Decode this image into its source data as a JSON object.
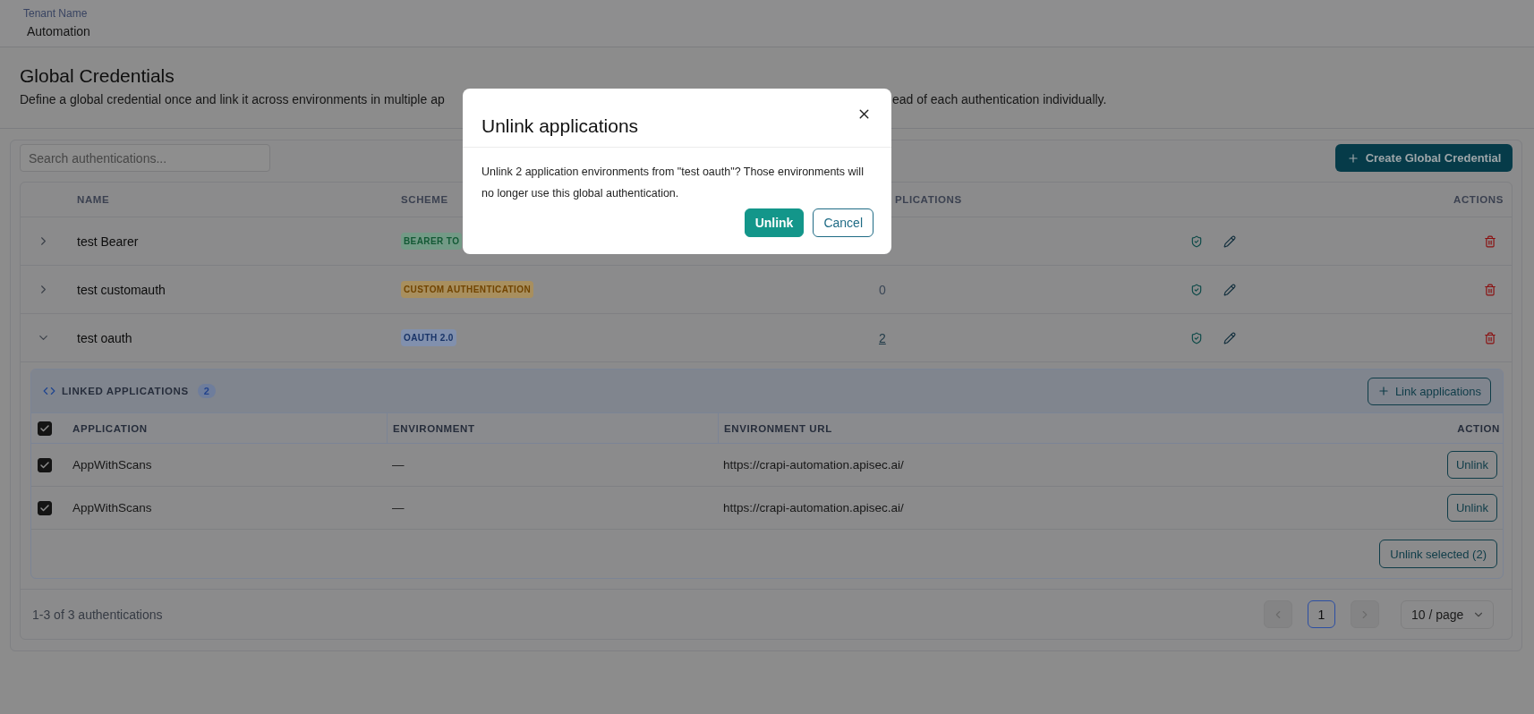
{
  "header": {
    "label": "Tenant Name",
    "value": "Automation"
  },
  "page": {
    "title": "Global Credentials",
    "description": [
      "Define a global credential once and link it across environments in multiple ap",
      "ead of each authentication individually."
    ]
  },
  "toolbar": {
    "search": {
      "placeholder": "Search authentications..."
    },
    "create_button": "Create Global Credential"
  },
  "table": {
    "columns": [
      "NAME",
      "SCHEME",
      "PLICATIONS",
      "ACTIONS"
    ],
    "rows": [
      {
        "name": "test Bearer",
        "expanded": false,
        "scheme": {
          "label": "BEARER TO",
          "color": "#739a86"
        }
      },
      {
        "name": "test customauth",
        "expanded": false,
        "scheme": {
          "label": "CUSTOM AUTHENTICATION",
          "color": "#a88f5e"
        },
        "applications": {
          "text": "0",
          "link": false
        }
      },
      {
        "name": "test oauth",
        "expanded": true,
        "scheme": {
          "label": "OAUTH 2.0",
          "color": "#8190ad"
        },
        "applications": {
          "text": "2",
          "link": true
        },
        "linked_applications": {
          "title": "LINKED APPLICATIONS",
          "count": "2",
          "link_button": "Link applications",
          "select_all": {
            "checked": true
          },
          "columns": [
            "APPLICATION",
            "ENVIRONMENT",
            "ENVIRONMENT URL",
            "ACTION"
          ],
          "rows": [
            {
              "checked": true,
              "application": "AppWithScans",
              "environment": "—",
              "url": "https://crapi-automation.apisec.ai/",
              "action": "Unlink"
            },
            {
              "checked": true,
              "application": "AppWithScans",
              "environment": "—",
              "url": "https://crapi-automation.apisec.ai/",
              "action": "Unlink"
            }
          ],
          "bulk_button": "Unlink selected (2)"
        }
      }
    ]
  },
  "pagination": {
    "summary": "1-3 of 3 authentications",
    "prev": {
      "disabled": true
    },
    "pages": [
      {
        "label": "1",
        "selected": true
      }
    ],
    "next": {
      "disabled": true
    },
    "page_size": "10 / page"
  },
  "dialog": {
    "title": "Unlink applications",
    "message": "Unlink 2 application environments from \"test oauth\"? Those environments will no longer use this global authentication.",
    "buttons": [
      {
        "label": "Unlink",
        "kind": "primary"
      },
      {
        "label": "Cancel",
        "kind": "secondary"
      }
    ]
  }
}
